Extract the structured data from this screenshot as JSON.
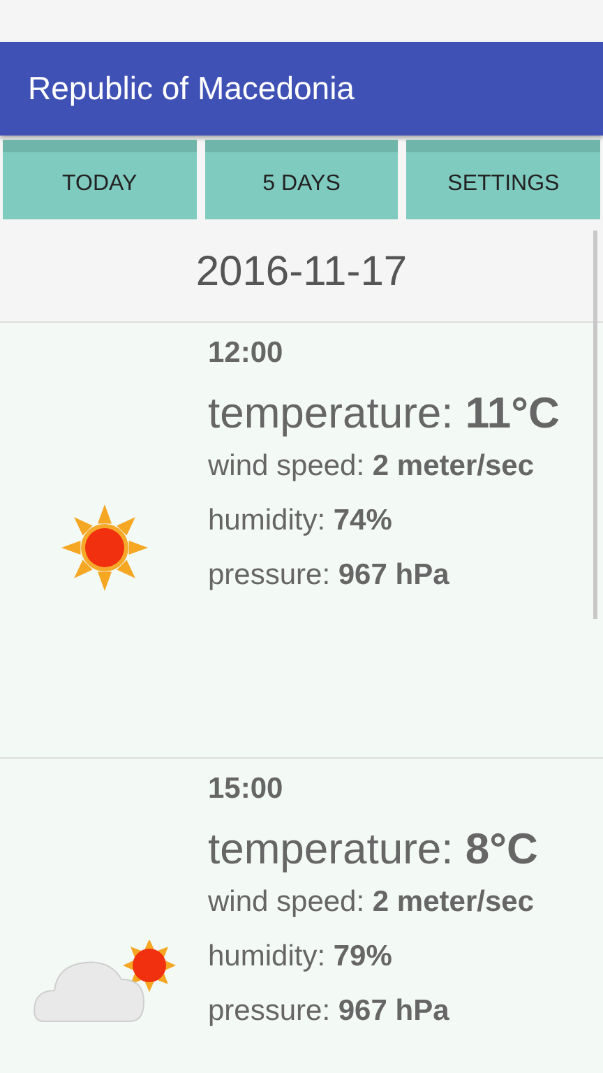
{
  "app_bar": {
    "title": "Republic of Macedonia"
  },
  "buttons": [
    "TODAY",
    "5 DAYS",
    "SETTINGS"
  ],
  "date": "2016-11-17",
  "forecasts": [
    {
      "kind": "sun",
      "time": "12:00",
      "temperature": "temperature: **11°C**",
      "wind": "wind speed: **2 meter/sec**",
      "humidity": "humidity: **74%**",
      "pressure": "pressure: **967 hPa**"
    },
    {
      "kind": "cloud-sun",
      "time": "15:00",
      "temperature": "temperature: **8°C**",
      "wind": "wind speed: **2 meter/sec**",
      "humidity": "humidity: **79%**",
      "pressure": "pressure: **967 hPa**"
    }
  ]
}
